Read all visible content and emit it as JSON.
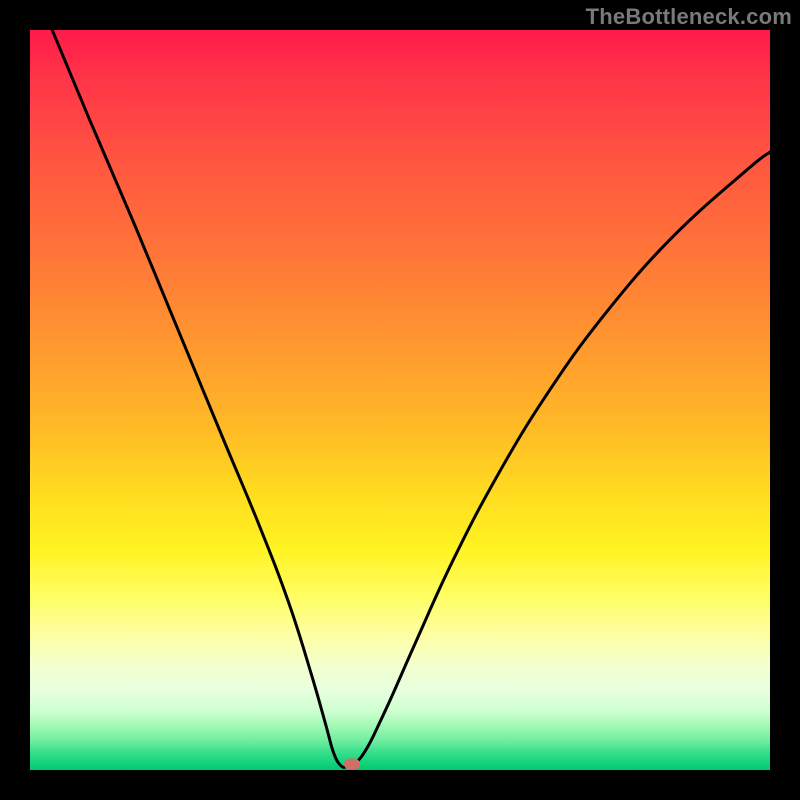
{
  "watermark": "TheBottleneck.com",
  "colors": {
    "page_bg": "#000000",
    "marker": "#cf6f65",
    "curve": "#000000",
    "watermark": "#79797b"
  },
  "chart_data": {
    "type": "line",
    "title": "",
    "xlabel": "",
    "ylabel": "",
    "xlim": [
      0,
      100
    ],
    "ylim": [
      0,
      100
    ],
    "grid": false,
    "legend": false,
    "notes": "Bottleneck curve. Y-axis read as percentage from top (100) to bottom (0). Minimum near x≈42 at y≈0. Marker overlaps minimum.",
    "series": [
      {
        "name": "bottleneck-curve",
        "x": [
          0,
          3,
          8,
          14,
          20,
          26,
          31,
          35,
          38,
          40,
          41,
          42,
          43,
          45,
          48,
          52,
          57,
          63,
          70,
          78,
          87,
          97,
          100
        ],
        "y": [
          107,
          100,
          88,
          74,
          59.5,
          45,
          33,
          22.5,
          13,
          6,
          2.4,
          0.6,
          0.6,
          2.1,
          8,
          17,
          28,
          39.5,
          51,
          62,
          72.2,
          81.2,
          83.5
        ]
      }
    ],
    "marker": {
      "x": 43.5,
      "y": 0.8
    },
    "gradient_background": {
      "stops": [
        {
          "pos": 0.0,
          "color": "#ff1a4a"
        },
        {
          "pos": 0.5,
          "color": "#ffb728"
        },
        {
          "pos": 0.75,
          "color": "#fffb40"
        },
        {
          "pos": 1.0,
          "color": "#00c96f"
        }
      ]
    }
  }
}
